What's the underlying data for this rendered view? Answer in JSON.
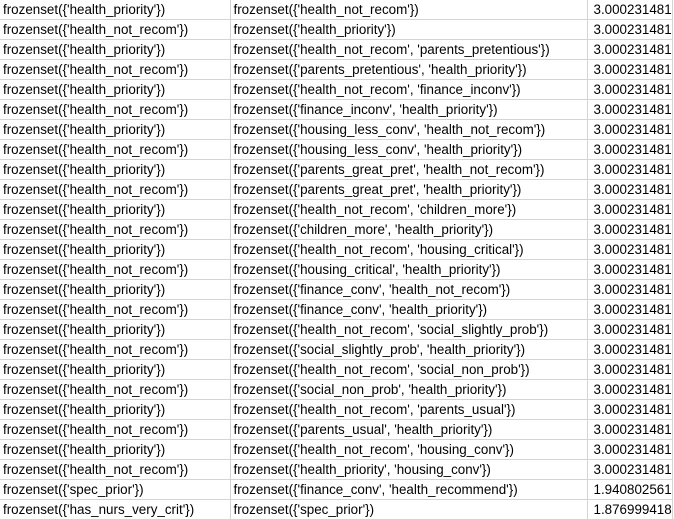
{
  "rows": [
    {
      "antecedent": "frozenset({'health_priority'})",
      "consequent": "frozenset({'health_not_recom'})",
      "value": "3.000231481"
    },
    {
      "antecedent": "frozenset({'health_not_recom'})",
      "consequent": "frozenset({'health_priority'})",
      "value": "3.000231481"
    },
    {
      "antecedent": "frozenset({'health_priority'})",
      "consequent": "frozenset({'health_not_recom', 'parents_pretentious'})",
      "value": "3.000231481"
    },
    {
      "antecedent": "frozenset({'health_not_recom'})",
      "consequent": "frozenset({'parents_pretentious', 'health_priority'})",
      "value": "3.000231481"
    },
    {
      "antecedent": "frozenset({'health_priority'})",
      "consequent": "frozenset({'health_not_recom', 'finance_inconv'})",
      "value": "3.000231481"
    },
    {
      "antecedent": "frozenset({'health_not_recom'})",
      "consequent": "frozenset({'finance_inconv', 'health_priority'})",
      "value": "3.000231481"
    },
    {
      "antecedent": "frozenset({'health_priority'})",
      "consequent": "frozenset({'housing_less_conv', 'health_not_recom'})",
      "value": "3.000231481"
    },
    {
      "antecedent": "frozenset({'health_not_recom'})",
      "consequent": "frozenset({'housing_less_conv', 'health_priority'})",
      "value": "3.000231481"
    },
    {
      "antecedent": "frozenset({'health_priority'})",
      "consequent": "frozenset({'parents_great_pret', 'health_not_recom'})",
      "value": "3.000231481"
    },
    {
      "antecedent": "frozenset({'health_not_recom'})",
      "consequent": "frozenset({'parents_great_pret', 'health_priority'})",
      "value": "3.000231481"
    },
    {
      "antecedent": "frozenset({'health_priority'})",
      "consequent": "frozenset({'health_not_recom', 'children_more'})",
      "value": "3.000231481"
    },
    {
      "antecedent": "frozenset({'health_not_recom'})",
      "consequent": "frozenset({'children_more', 'health_priority'})",
      "value": "3.000231481"
    },
    {
      "antecedent": "frozenset({'health_priority'})",
      "consequent": "frozenset({'health_not_recom', 'housing_critical'})",
      "value": "3.000231481"
    },
    {
      "antecedent": "frozenset({'health_not_recom'})",
      "consequent": "frozenset({'housing_critical', 'health_priority'})",
      "value": "3.000231481"
    },
    {
      "antecedent": "frozenset({'health_priority'})",
      "consequent": "frozenset({'finance_conv', 'health_not_recom'})",
      "value": "3.000231481"
    },
    {
      "antecedent": "frozenset({'health_not_recom'})",
      "consequent": "frozenset({'finance_conv', 'health_priority'})",
      "value": "3.000231481"
    },
    {
      "antecedent": "frozenset({'health_priority'})",
      "consequent": "frozenset({'health_not_recom', 'social_slightly_prob'})",
      "value": "3.000231481"
    },
    {
      "antecedent": "frozenset({'health_not_recom'})",
      "consequent": "frozenset({'social_slightly_prob', 'health_priority'})",
      "value": "3.000231481"
    },
    {
      "antecedent": "frozenset({'health_priority'})",
      "consequent": "frozenset({'health_not_recom', 'social_non_prob'})",
      "value": "3.000231481"
    },
    {
      "antecedent": "frozenset({'health_not_recom'})",
      "consequent": "frozenset({'social_non_prob', 'health_priority'})",
      "value": "3.000231481"
    },
    {
      "antecedent": "frozenset({'health_priority'})",
      "consequent": "frozenset({'health_not_recom', 'parents_usual'})",
      "value": "3.000231481"
    },
    {
      "antecedent": "frozenset({'health_not_recom'})",
      "consequent": "frozenset({'parents_usual', 'health_priority'})",
      "value": "3.000231481"
    },
    {
      "antecedent": "frozenset({'health_priority'})",
      "consequent": "frozenset({'health_not_recom', 'housing_conv'})",
      "value": "3.000231481"
    },
    {
      "antecedent": "frozenset({'health_not_recom'})",
      "consequent": "frozenset({'health_priority', 'housing_conv'})",
      "value": "3.000231481"
    },
    {
      "antecedent": "frozenset({'spec_prior'})",
      "consequent": "frozenset({'finance_conv', 'health_recommend'})",
      "value": "1.940802561"
    },
    {
      "antecedent": "frozenset({'has_nurs_very_crit'})",
      "consequent": "frozenset({'spec_prior'})",
      "value": "1.876999418"
    }
  ]
}
